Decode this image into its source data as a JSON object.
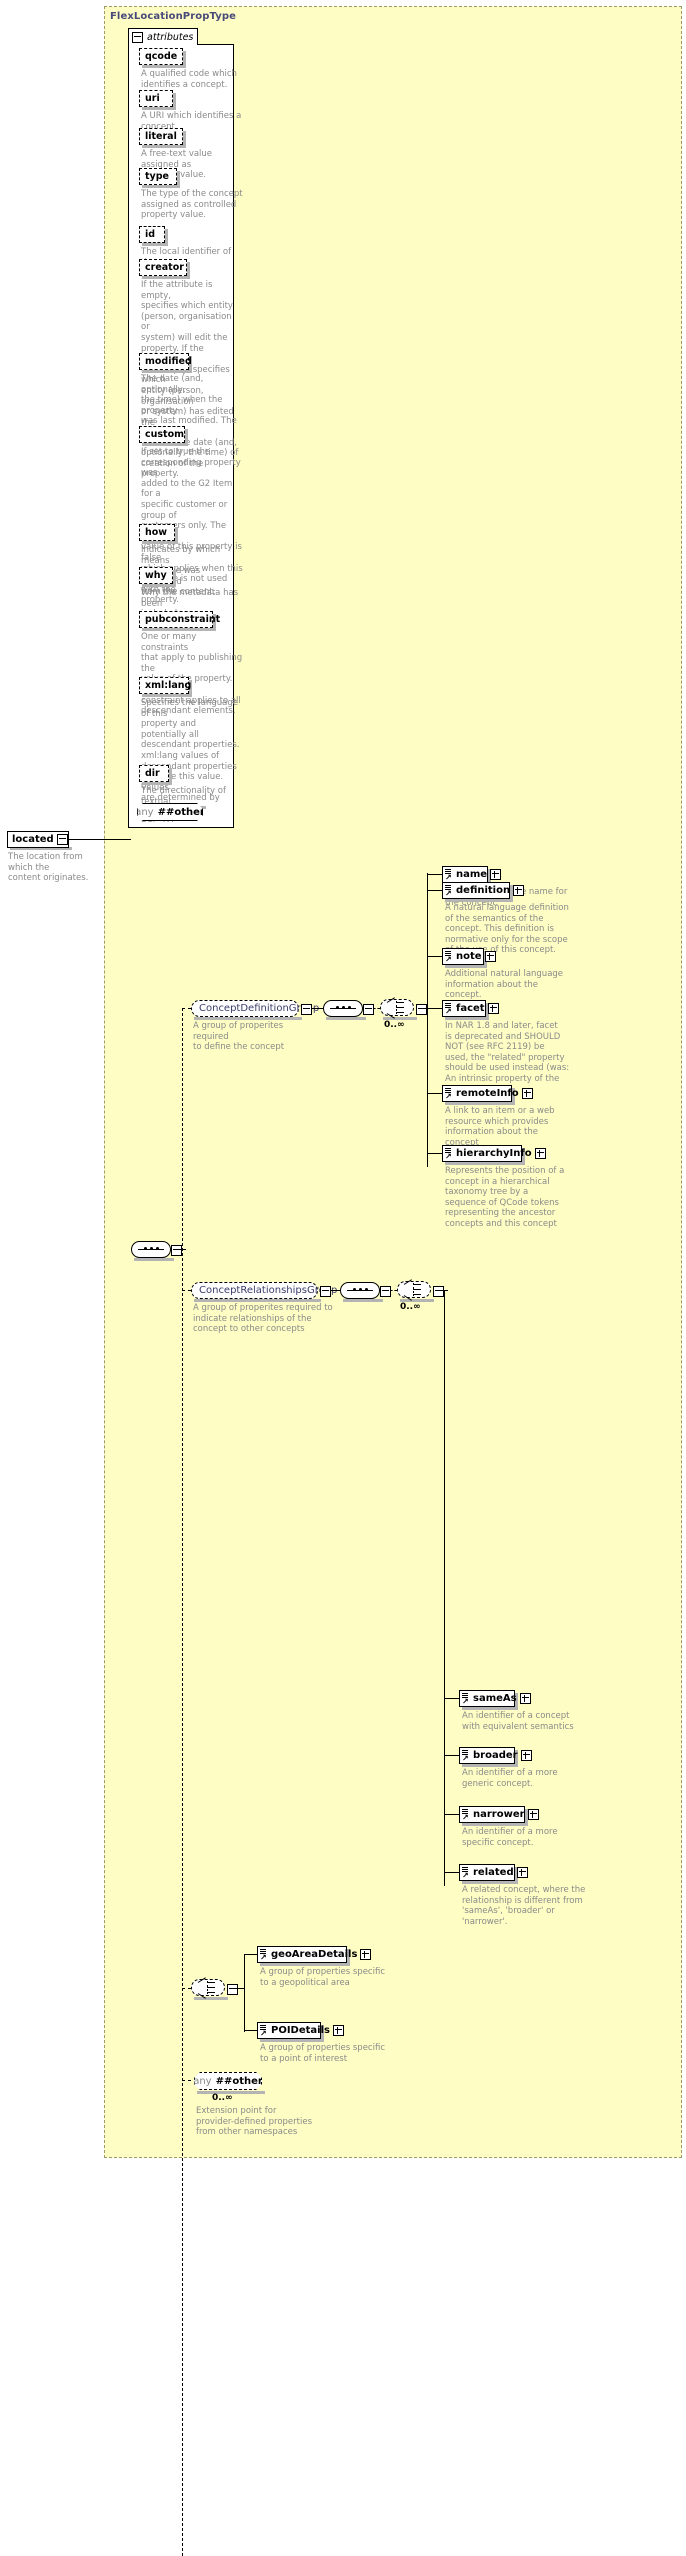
{
  "diagram": {
    "type_title": "FlexLocationPropType",
    "attributes_label": "attributes",
    "root_element": {
      "name": "located",
      "desc": "The location from which the\ncontent originates."
    },
    "attributes": [
      {
        "name": "qcode",
        "desc": "A qualified code which\nidentifies a concept."
      },
      {
        "name": "uri",
        "desc": "A URI which identifies a\nconcept."
      },
      {
        "name": "literal",
        "desc": "A free-text value assigned as\nproperty value."
      },
      {
        "name": "type",
        "desc": "The type of the concept\nassigned as controlled\nproperty value."
      },
      {
        "name": "id",
        "desc": "The local identifier of the\nproperty."
      },
      {
        "name": "creator",
        "desc": "If the attribute is empty,\nspecifies which entity\n(person, organisation or\nsystem) will edit the\nproperty. If the attribute is\nnon-empty, specifies which\nentity (person, organisation\nor system) has edited the\nproperty."
      },
      {
        "name": "modified",
        "desc": "The date (and, optionally,\nthe time) when the property\nwas last modified. The initial\nvalue is the date (and,\noptionally, the time) of\ncreation of the property."
      },
      {
        "name": "custom",
        "desc": "If set to true the\ncorresponding property was\nadded to the G2 Item for a\nspecific customer or group of\ncustomers only. The default\nvalue of this property is false\nwhich applies when this\nattribute is not used with the\nproperty."
      },
      {
        "name": "how",
        "desc": "Indicates by which means\nthe value was extracted\nfrom the content."
      },
      {
        "name": "why",
        "desc": "Why the metadata has been\nincluded."
      },
      {
        "name": "pubconstraint",
        "desc": "One or many constraints\nthat apply to publishing the\nvalue of the property. Each\nconstraint applies to all\ndescendant elements."
      },
      {
        "name": "xml:lang",
        "desc": "Specifies the language of this\nproperty and potentially all\ndescendant properties.\nxml:lang values of\ndescendant properties\noverride this value. Values\nare determined by Internet\nBCP 47."
      },
      {
        "name": "dir",
        "desc": "The directionality of textual\ncontent."
      }
    ],
    "attribute_any": {
      "prefix": "any",
      "namespace": "##other"
    },
    "groups": [
      {
        "name": "ConceptDefinitionGroup",
        "desc": "A group of properites required\nto define the concept",
        "cardinality": "0..∞",
        "children": [
          {
            "name": "name",
            "desc": "A natural language name for\nthe concept."
          },
          {
            "name": "definition",
            "desc": "A natural language definition\nof the semantics of the\nconcept. This definition is\nnormative only for the scope\nof the use of this concept."
          },
          {
            "name": "note",
            "desc": "Additional natural language\ninformation about the\nconcept."
          },
          {
            "name": "facet",
            "desc": "In NAR 1.8 and later, facet\nis deprecated and SHOULD\nNOT (see RFC 2119) be\nused, the \"related\" property\nshould be used instead (was:\nAn intrinsic property of the\nconcept.)"
          },
          {
            "name": "remoteInfo",
            "desc": "A link to an item or a web\nresource which provides\ninformation about the\nconcept"
          },
          {
            "name": "hierarchyInfo",
            "desc": "Represents the position of a\nconcept in a hierarchical\ntaxonomy tree by a\nsequence of QCode tokens\nrepresenting the ancestor\nconcepts and this concept"
          }
        ]
      },
      {
        "name": "ConceptRelationshipsGroup",
        "desc": "A group of properites required to\nindicate relationships of the\nconcept to other concepts",
        "cardinality": "0..∞",
        "children": [
          {
            "name": "sameAs",
            "desc": "An identifier of a concept\nwith equivalent semantics"
          },
          {
            "name": "broader",
            "desc": "An identifier of a more\ngeneric concept."
          },
          {
            "name": "narrower",
            "desc": "An identifier of a more\nspecific concept."
          },
          {
            "name": "related",
            "desc": "A related concept, where the\nrelationship is different from\n'sameAs', 'broader' or\n'narrower'."
          }
        ]
      }
    ],
    "detail_choice": {
      "children": [
        {
          "name": "geoAreaDetails",
          "desc": "A group of properties specific\nto a geopolitical area"
        },
        {
          "name": "POIDetails",
          "desc": "A group of properties specific\nto a point of interest"
        }
      ]
    },
    "element_any": {
      "prefix": "any",
      "namespace": "##other",
      "cardinality": "0..∞",
      "desc": "Extension point for\nprovider-defined properties\nfrom other namespaces"
    },
    "colors": {
      "type_background": "#fdfdc4",
      "type_border": "#9a9a6e",
      "title_text": "#4a4a7a",
      "desc_text": "#8a8a8a",
      "group_text": "#3b3b6b",
      "shadow": "#b4b4b4"
    }
  }
}
